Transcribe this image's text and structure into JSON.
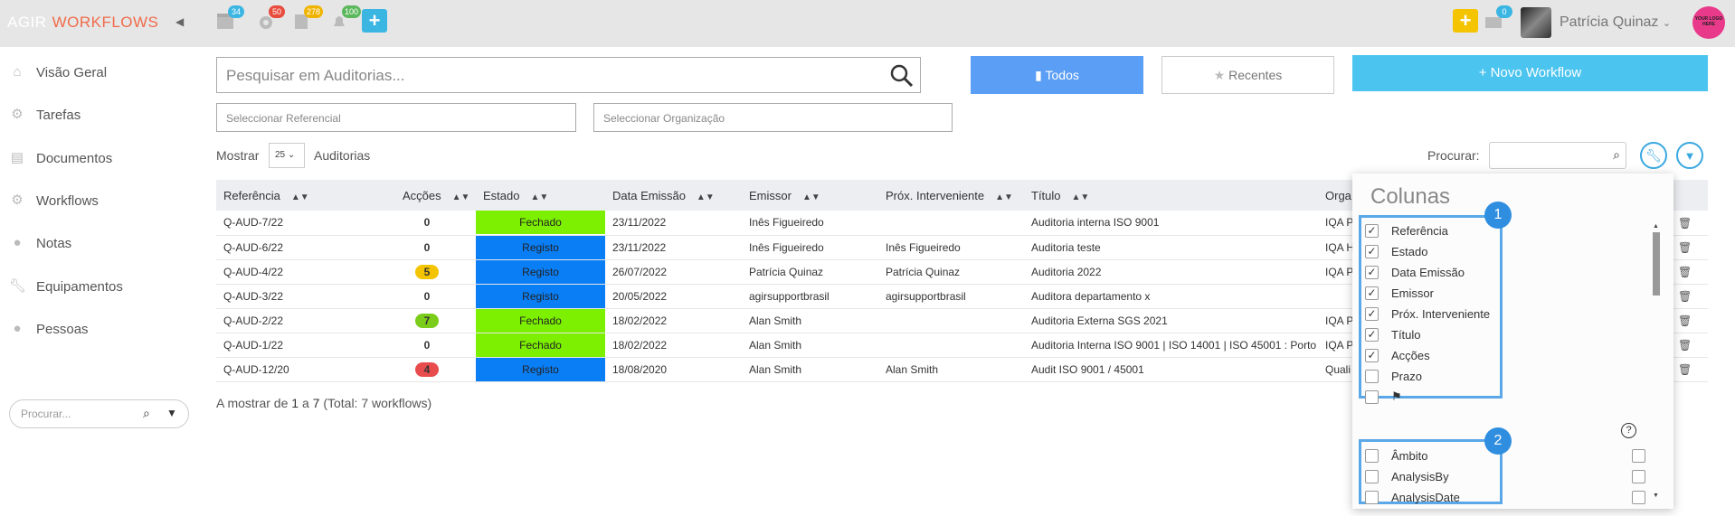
{
  "header": {
    "brand_primary": "AGIR",
    "brand_secondary": "WORKFLOWS",
    "badges": [
      {
        "icon": "calendar-icon",
        "count": "34",
        "color": "#3bb6e3"
      },
      {
        "icon": "gear-icon",
        "count": "50",
        "color": "#e84c3d"
      },
      {
        "icon": "document-icon",
        "count": "278",
        "color": "#f0b400"
      },
      {
        "icon": "bell-icon",
        "count": "100",
        "color": "#5cb85c"
      }
    ],
    "mail_count": "0",
    "user_name": "Patrícia Quinaz",
    "logo_text": "YOUR LOGO HERE"
  },
  "sidebar": {
    "items": [
      {
        "label": "Visão Geral",
        "icon": "home-icon"
      },
      {
        "label": "Tarefas",
        "icon": "gear-icon"
      },
      {
        "label": "Documentos",
        "icon": "document-icon"
      },
      {
        "label": "Workflows",
        "icon": "gears-icon"
      },
      {
        "label": "Notas",
        "icon": "comment-icon"
      },
      {
        "label": "Equipamentos",
        "icon": "wrench-icon"
      },
      {
        "label": "Pessoas",
        "icon": "user-icon"
      }
    ],
    "search_placeholder": "Procurar..."
  },
  "main": {
    "search_placeholder": "Pesquisar em Auditorias...",
    "btn_all": "Todos",
    "btn_recent": "Recentes",
    "btn_new": "Novo Workflow",
    "select_ref": "Seleccionar Referencial",
    "select_org": "Seleccionar Organização",
    "show_label": "Mostrar",
    "page_size": "25",
    "show_suffix": "Auditorias",
    "procurar_label": "Procurar:",
    "footer": {
      "prefix": "A mostrar de ",
      "from": "1",
      "mid": " a ",
      "to": "7",
      "total_prefix": " (Total: ",
      "total": "7",
      "total_suffix": " workflows)"
    }
  },
  "table": {
    "columns": [
      "Referência",
      "Acções",
      "Estado",
      "Data Emissão",
      "Emissor",
      "Próx. Interveniente",
      "Título",
      "Orga"
    ],
    "rows": [
      {
        "ref": "Q-AUD-7/22",
        "accoes": "0",
        "accoes_color": "",
        "estado": "Fechado",
        "estado_color": "#7cf000",
        "data": "23/11/2022",
        "emissor": "Inês Figueiredo",
        "prox": "",
        "titulo": "Auditoria interna ISO 9001",
        "org": "IQA P"
      },
      {
        "ref": "Q-AUD-6/22",
        "accoes": "0",
        "accoes_color": "",
        "estado": "Registo",
        "estado_color": "#0a7ef5",
        "data": "23/11/2022",
        "emissor": "Inês Figueiredo",
        "prox": "Inês Figueiredo",
        "titulo": "Auditoria teste",
        "org": "IQA H"
      },
      {
        "ref": "Q-AUD-4/22",
        "accoes": "5",
        "accoes_color": "#f5c400",
        "estado": "Registo",
        "estado_color": "#0a7ef5",
        "data": "26/07/2022",
        "emissor": "Patrícia Quinaz",
        "prox": "Patrícia Quinaz",
        "titulo": "Auditoria 2022",
        "org": "IQA P"
      },
      {
        "ref": "Q-AUD-3/22",
        "accoes": "0",
        "accoes_color": "",
        "estado": "Registo",
        "estado_color": "#0a7ef5",
        "data": "20/05/2022",
        "emissor": "agirsupportbrasil",
        "prox": "agirsupportbrasil",
        "titulo": "Auditora departamento x",
        "org": ""
      },
      {
        "ref": "Q-AUD-2/22",
        "accoes": "7",
        "accoes_color": "#7ccc1c",
        "estado": "Fechado",
        "estado_color": "#7cf000",
        "data": "18/02/2022",
        "emissor": "Alan Smith",
        "prox": "",
        "titulo": "Auditoria Externa SGS 2021",
        "org": "IQA P"
      },
      {
        "ref": "Q-AUD-1/22",
        "accoes": "0",
        "accoes_color": "",
        "estado": "Fechado",
        "estado_color": "#7cf000",
        "data": "18/02/2022",
        "emissor": "Alan Smith",
        "prox": "",
        "titulo": "Auditoria Interna ISO 9001 | ISO 14001 | ISO 45001 : Porto",
        "org": "IQA P"
      },
      {
        "ref": "Q-AUD-12/20",
        "accoes": "4",
        "accoes_color": "#e84c4c",
        "estado": "Registo",
        "estado_color": "#0a7ef5",
        "data": "18/08/2020",
        "emissor": "Alan Smith",
        "prox": "Alan Smith",
        "titulo": "Audit ISO 9001 / 45001",
        "org": "Quali"
      }
    ]
  },
  "columns_panel": {
    "title": "Colunas",
    "group1": [
      {
        "label": "Referência",
        "checked": true
      },
      {
        "label": "Estado",
        "checked": true
      },
      {
        "label": "Data Emissão",
        "checked": true
      },
      {
        "label": "Emissor",
        "checked": true
      },
      {
        "label": "Próx. Interveniente",
        "checked": true
      },
      {
        "label": "Título",
        "checked": true
      },
      {
        "label": "Acções",
        "checked": true
      },
      {
        "label": "Prazo",
        "checked": false
      }
    ],
    "group2": [
      {
        "label": "Âmbito"
      },
      {
        "label": "AnalysisBy"
      },
      {
        "label": "AnalysisDate"
      }
    ],
    "badge1": "1",
    "badge2": "2"
  }
}
